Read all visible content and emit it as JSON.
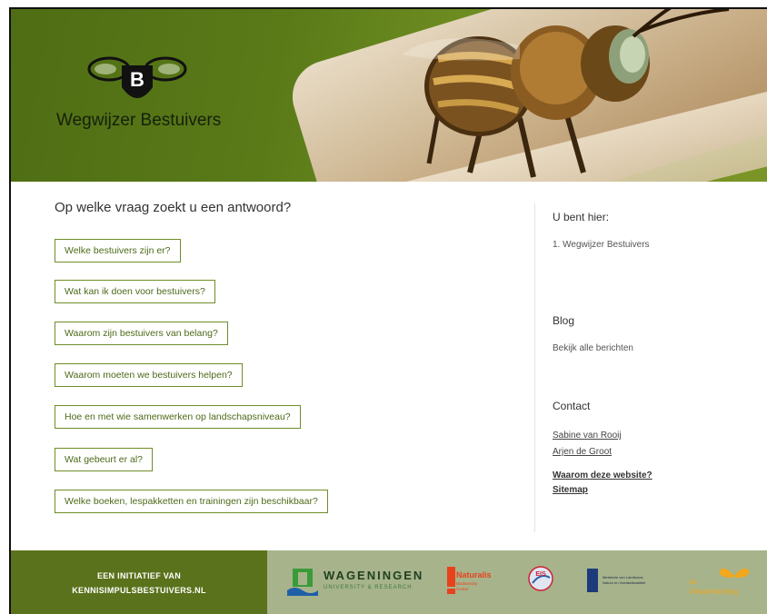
{
  "site": {
    "title": "Wegwijzer Bestuivers",
    "logo_letter": "B"
  },
  "main": {
    "question": "Op welke vraag zoekt u een antwoord?",
    "buttons": [
      "Welke bestuivers zijn er?",
      "Wat kan ik doen voor bestuivers?",
      "Waarom zijn bestuivers van belang?",
      "Waarom moeten we bestuivers helpen?",
      "Hoe en met wie samenwerken op landschapsniveau?",
      "Wat gebeurt er al?",
      "Welke boeken, lespakketten en trainingen zijn beschikbaar?"
    ]
  },
  "sidebar": {
    "breadcrumb_heading": "U bent hier:",
    "breadcrumb_item": "1. Wegwijzer Bestuivers",
    "blog_heading": "Blog",
    "blog_link": "Bekijk alle berichten",
    "contact_heading": "Contact",
    "contacts": [
      "Sabine van Rooij",
      "Arjen de Groot"
    ],
    "links": [
      "Waarom deze website?",
      "Sitemap"
    ]
  },
  "footer": {
    "initiative_line1": "EEN INITIATIEF VAN",
    "initiative_line2": "KENNISIMPULSBESTUIVERS.NL",
    "wur_name": "WAGENINGEN",
    "wur_sub": "UNIVERSITY & RESEARCH",
    "naturalis_name": "Naturalis",
    "naturalis_sub1": "Biodiversity",
    "naturalis_sub2": "Center",
    "eis_label": "EIS",
    "ministry_line1": "Ministerie van Landbouw,",
    "ministry_line2": "Natuur en Voedselkwaliteit",
    "vlinder_line1": "De",
    "vlinder_line2": "Vlinderstichting"
  },
  "colors": {
    "hero_green": "#5a7a18",
    "accent": "#6e8d2a",
    "footer_green": "#5a721b",
    "footer_sage": "#a7b38b"
  }
}
